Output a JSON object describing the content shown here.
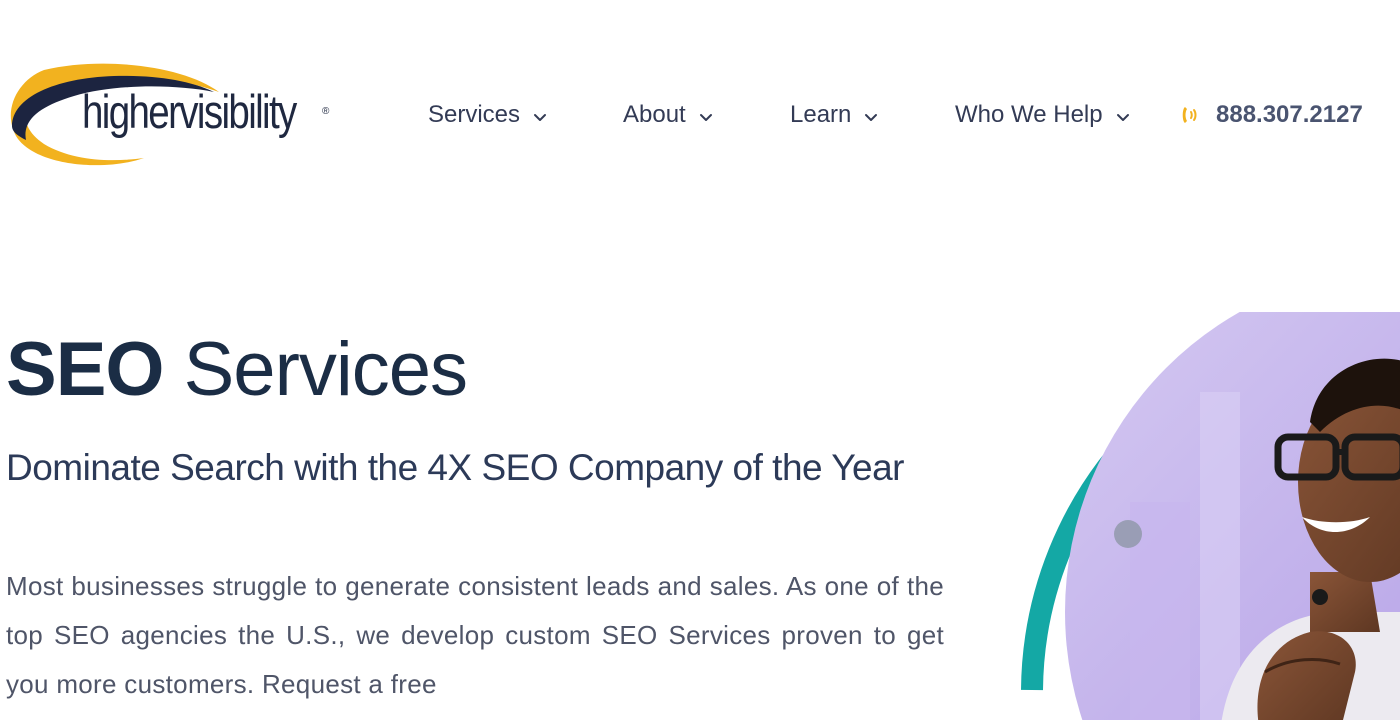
{
  "header": {
    "logo": {
      "text": "highervisibility",
      "registered_mark": "®",
      "colors": {
        "swoosh_gold": "#f2b21f",
        "swoosh_navy": "#1c2440"
      }
    },
    "nav": [
      {
        "label": "Services",
        "icon": "chevron-down-icon"
      },
      {
        "label": "About",
        "icon": "chevron-down-icon"
      },
      {
        "label": "Learn",
        "icon": "chevron-down-icon"
      },
      {
        "label": "Who We Help",
        "icon": "chevron-down-icon"
      }
    ],
    "phone": {
      "number": "888.307.2127",
      "icon": "phone-icon",
      "icon_color": "#f2b21f"
    }
  },
  "hero": {
    "title_bold": "SEO",
    "title_light": " Services",
    "subtitle": "Dominate Search with the 4X SEO Company of the Year",
    "body": "Most businesses struggle to generate consistent leads and sales. As one of the top SEO agencies the U.S., we develop custom SEO Services proven to get you more customers. Request a free",
    "image": {
      "description_icon": "smiling-woman-photo",
      "ring_color": "#14a8a5",
      "backdrop_color": "#cbbbee"
    }
  },
  "colors": {
    "heading": "#1b2d45",
    "nav_text": "#333b55",
    "body_text": "#4f5568",
    "accent_gold": "#f2b21f",
    "accent_teal": "#14a8a5"
  }
}
